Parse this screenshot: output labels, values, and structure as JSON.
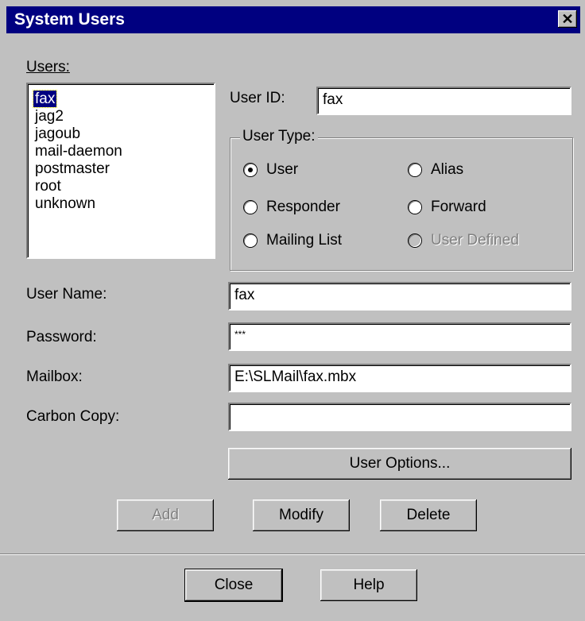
{
  "window": {
    "title": "System Users",
    "close_glyph": "✕"
  },
  "users": {
    "label": "Users:",
    "items": [
      "fax",
      "jag2",
      "jagoub",
      "mail-daemon",
      "postmaster",
      "root",
      "unknown"
    ],
    "selected": "fax"
  },
  "user_id": {
    "label": "User ID:",
    "value": "fax"
  },
  "user_type": {
    "label": "User Type:",
    "options": [
      {
        "label": "User",
        "checked": true,
        "enabled": true
      },
      {
        "label": "Alias",
        "checked": false,
        "enabled": true
      },
      {
        "label": "Responder",
        "checked": false,
        "enabled": true
      },
      {
        "label": "Forward",
        "checked": false,
        "enabled": true
      },
      {
        "label": "Mailing List",
        "checked": false,
        "enabled": true
      },
      {
        "label": "User Defined",
        "checked": false,
        "enabled": false
      }
    ]
  },
  "fields": {
    "user_name": {
      "label": "User Name:",
      "value": "fax"
    },
    "password": {
      "label": "Password:",
      "value": "***"
    },
    "mailbox": {
      "label": "Mailbox:",
      "value": "E:\\SLMail\\fax.mbx"
    },
    "carbon_copy": {
      "label": "Carbon Copy:",
      "value": ""
    }
  },
  "buttons": {
    "user_options": "User Options...",
    "add": "Add",
    "modify": "Modify",
    "delete": "Delete",
    "close": "Close",
    "help": "Help"
  },
  "colors": {
    "title_bar": "#000080",
    "face": "#c0c0c0",
    "selection": "#000080"
  }
}
